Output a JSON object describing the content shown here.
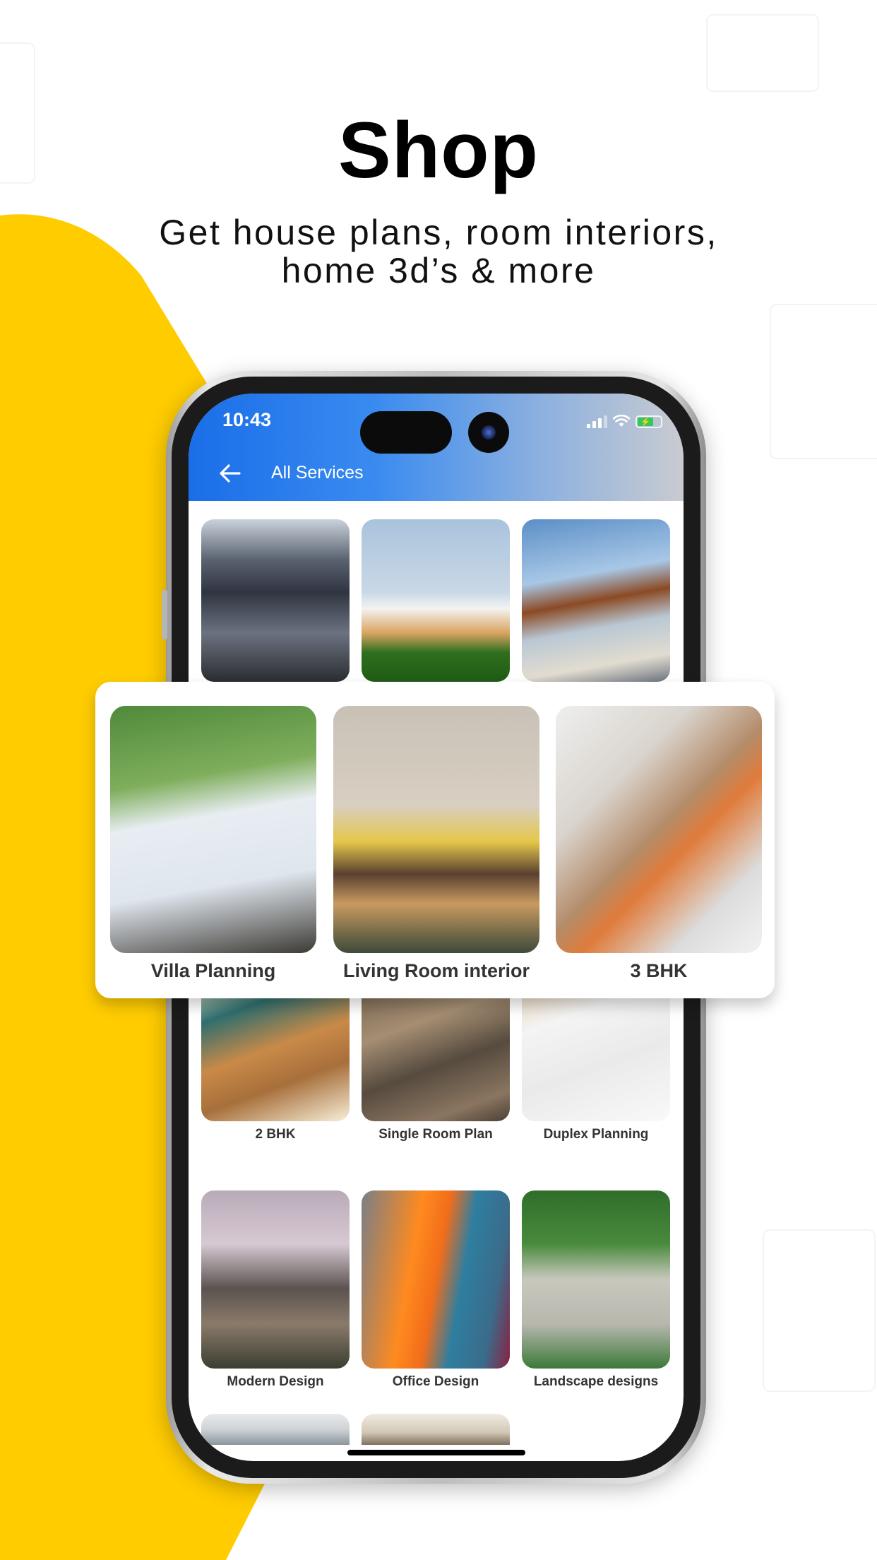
{
  "hero": {
    "title": "Shop",
    "subtitle_line1": "Get house plans, room interiors,",
    "subtitle_line2": "home 3d’s & more"
  },
  "colors": {
    "accent_yellow": "#FFCC00",
    "appbar_blue": "#1A6EE8",
    "battery_green": "#34C759"
  },
  "status_bar": {
    "time": "10:43",
    "icons": [
      "signal-icon",
      "wifi-icon",
      "battery-charging-icon"
    ]
  },
  "appbar": {
    "back_icon": "arrow-left-icon",
    "title": "All Services"
  },
  "services_grid": [
    {
      "label": "",
      "image": "classic-house"
    },
    {
      "label": "",
      "image": "modern-house"
    },
    {
      "label": "",
      "image": "wood-house"
    },
    {
      "label": "2 BHK",
      "image": "2bhk-isometric"
    },
    {
      "label": "Single Room Plan",
      "image": "single-room-topdown"
    },
    {
      "label": "Duplex  Planning",
      "image": "duplex-blueprint"
    },
    {
      "label": "Modern Design",
      "image": "modern-villa"
    },
    {
      "label": "Office Design",
      "image": "office-interior"
    },
    {
      "label": "Landscape designs",
      "image": "landscape-park"
    },
    {
      "label": "",
      "image": "partial-white-house"
    },
    {
      "label": "",
      "image": "partial-interior"
    }
  ],
  "featured_popup": [
    {
      "label": "Villa Planning",
      "image": "villa-planning"
    },
    {
      "label": "Living Room interior",
      "image": "living-room"
    },
    {
      "label": "3 BHK",
      "image": "3bhk-floorplan"
    }
  ]
}
